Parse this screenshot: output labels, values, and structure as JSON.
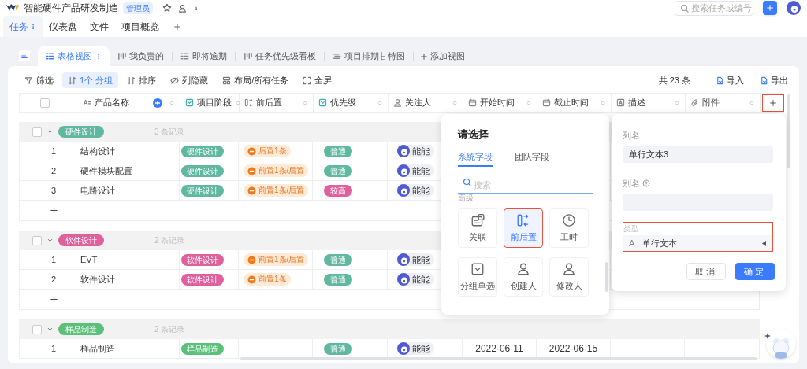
{
  "app": {
    "title": "智能硬件产品研发制造",
    "role": "管理员",
    "search_placeholder": "搜索任务或编号"
  },
  "nav_tabs": [
    {
      "label": "任务",
      "selected": true
    },
    {
      "label": "仪表盘",
      "selected": false
    },
    {
      "label": "文件",
      "selected": false
    },
    {
      "label": "项目概览",
      "selected": false
    }
  ],
  "view_tabs": [
    {
      "label": "表格视图",
      "kind": "table",
      "selected": true
    },
    {
      "label": "我负责的",
      "kind": "board",
      "selected": false
    },
    {
      "label": "即将逾期",
      "kind": "table",
      "selected": false
    },
    {
      "label": "任务优先级看板",
      "kind": "board",
      "selected": false
    },
    {
      "label": "项目排期甘特图",
      "kind": "gantt",
      "selected": false
    }
  ],
  "add_view": "添加视图",
  "toolbar": {
    "tools": [
      {
        "label": "筛选",
        "kind": "filter",
        "selected": false
      },
      {
        "label": "1个 分组",
        "kind": "group",
        "selected": true
      },
      {
        "label": "排序",
        "kind": "sort",
        "selected": false
      },
      {
        "label": "列隐藏",
        "kind": "hide",
        "selected": false
      },
      {
        "label": "布局/所有任务",
        "kind": "layout",
        "selected": false
      },
      {
        "label": "全屏",
        "kind": "fullscreen",
        "selected": false
      }
    ],
    "total": "共 23 条",
    "actions": [
      "导入",
      "导出"
    ]
  },
  "table": {
    "columns": [
      {
        "label": "产品名称",
        "kind": "text"
      },
      {
        "label": "项目阶段",
        "kind": "select"
      },
      {
        "label": "前后置",
        "kind": "dependency"
      },
      {
        "label": "优先级",
        "kind": "select"
      },
      {
        "label": "关注人",
        "kind": "person"
      },
      {
        "label": "开始时间",
        "kind": "date"
      },
      {
        "label": "截止时间",
        "kind": "date"
      },
      {
        "label": "描述",
        "kind": "description"
      },
      {
        "label": "附件",
        "kind": "attachment"
      }
    ],
    "select_all_checked": false,
    "add_column_highlighted": true,
    "groups": [
      {
        "label": "硬件设计",
        "color": "#5fb89f",
        "checked": false,
        "count": "3 条记录",
        "rows": [
          {
            "index": "1",
            "name": "结构设计",
            "stage": "硬件设计",
            "dependency": "后置1条",
            "priority": {
              "label": "普通",
              "color": "#5fb89f"
            },
            "watcher": "能能"
          },
          {
            "index": "2",
            "name": "硬件模块配置",
            "stage": "硬件设计",
            "dependency": "前置1条/后置",
            "priority": {
              "label": "普通",
              "color": "#5fb89f"
            },
            "watcher": "能能"
          },
          {
            "index": "3",
            "name": "电路设计",
            "stage": "硬件设计",
            "dependency": "前置1条/后置",
            "priority": {
              "label": "较高",
              "color": "#e0609d"
            },
            "watcher": "能能"
          }
        ]
      },
      {
        "label": "软件设计",
        "color": "#e0609d",
        "checked": false,
        "count": "2 条记录",
        "rows": [
          {
            "index": "1",
            "name": "EVT",
            "stage": "软件设计",
            "dependency": "前置1条/后置",
            "priority": {
              "label": "普通",
              "color": "#5fb89f"
            },
            "watcher": "能能"
          },
          {
            "index": "2",
            "name": "软件设计",
            "stage": "软件设计",
            "dependency": "前置1条",
            "priority": {
              "label": "普通",
              "color": "#5fb89f"
            },
            "watcher": "能能"
          }
        ]
      },
      {
        "label": "样品制造",
        "color": "#5cc07a",
        "checked": false,
        "count": "2 条记录",
        "rows": [
          {
            "index": "1",
            "name": "样品制造",
            "stage": "样品制造",
            "priority": {
              "label": "普通",
              "color": "#5fb89f"
            },
            "watcher": "能能",
            "start": "2022-06-11",
            "end": "2022-06-15"
          }
        ]
      }
    ]
  },
  "field_picker": {
    "title": "请选择",
    "tabs": [
      {
        "label": "系统字段",
        "selected": true
      },
      {
        "label": "团队字段",
        "selected": false
      }
    ],
    "search_placeholder": "搜索",
    "section": "高级",
    "options": [
      {
        "label": "关联",
        "kind": "relation",
        "selected": false,
        "highlighted": false
      },
      {
        "label": "前后置",
        "kind": "dependency",
        "selected": true,
        "highlighted": true
      },
      {
        "label": "工时",
        "kind": "time",
        "selected": false,
        "highlighted": false
      },
      {
        "label": "分组单选",
        "kind": "select",
        "selected": false,
        "highlighted": false
      },
      {
        "label": "创建人",
        "kind": "person",
        "selected": false,
        "highlighted": false
      },
      {
        "label": "修改人",
        "kind": "person",
        "selected": false,
        "highlighted": false
      }
    ]
  },
  "column_editor": {
    "name_label": "列名",
    "name_value": "单行文本3",
    "alias_label": "别名",
    "type_label": "类型",
    "type_glyph": "A",
    "type_value": "单行文本",
    "type_highlighted": true,
    "buttons": [
      {
        "label": "取消",
        "kind": "secondary"
      },
      {
        "label": "确定",
        "kind": "primary"
      }
    ]
  }
}
